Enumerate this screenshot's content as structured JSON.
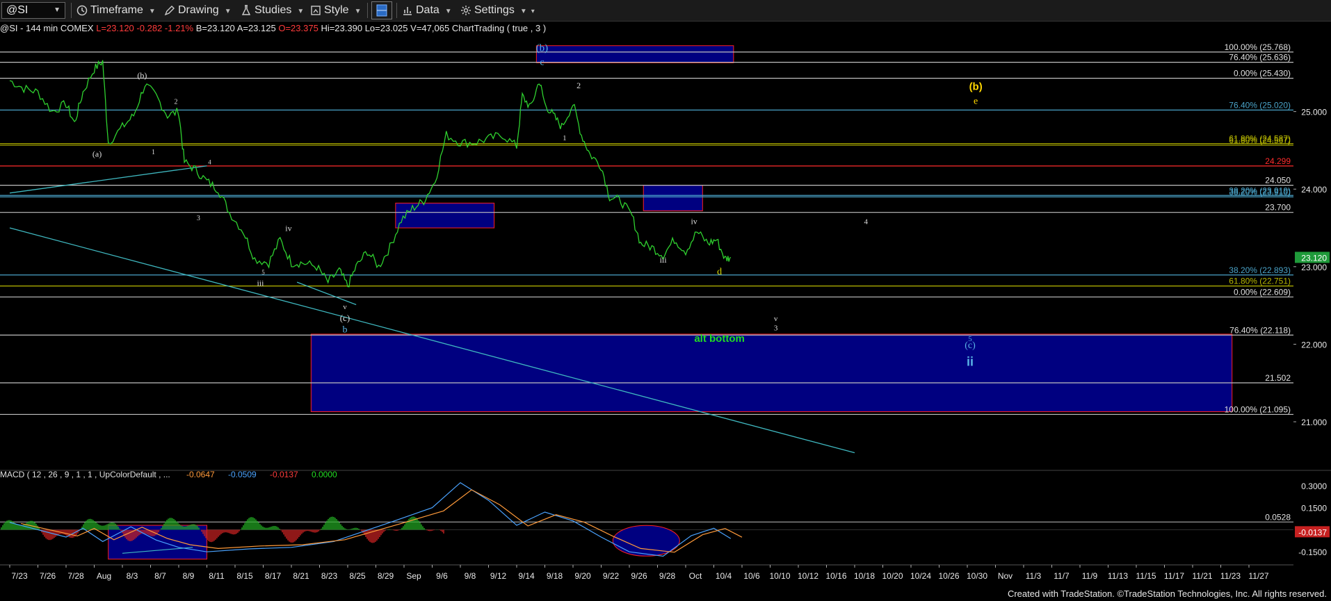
{
  "toolbar": {
    "symbol": "@SI",
    "timeframe": "Timeframe",
    "drawing": "Drawing",
    "studies": "Studies",
    "style": "Style",
    "data": "Data",
    "settings": "Settings"
  },
  "infoline": {
    "symbol": "@SI - 144 min",
    "exchange": "COMEX",
    "last": "L=23.120",
    "change": "-0.282",
    "change_pct": "-1.21%",
    "bid": "B=23.120",
    "ask": "A=23.125",
    "open": "O=23.375",
    "high": "Hi=23.390",
    "low": "Lo=23.025",
    "volume": "V=47,065",
    "study": "ChartTrading ( true , 3 )"
  },
  "footer": "Created with TradeStation. ©TradeStation Technologies, Inc. All rights reserved.",
  "chart_data": [
    {
      "type": "line",
      "title": "@SI - 144 min COMEX",
      "x_dates": [
        "7/23",
        "7/26",
        "7/28",
        "Aug",
        "8/3",
        "8/7",
        "8/9",
        "8/11",
        "8/15",
        "8/17",
        "8/21",
        "8/23",
        "8/25",
        "8/29",
        "Sep",
        "9/6",
        "9/8",
        "9/12",
        "9/14",
        "9/18",
        "9/20",
        "9/22",
        "9/26",
        "9/28",
        "Oct",
        "10/4",
        "10/6",
        "10/10",
        "10/12",
        "10/16",
        "10/18",
        "10/20",
        "10/24",
        "10/26",
        "10/30",
        "Nov",
        "11/3",
        "11/7",
        "11/9",
        "11/13",
        "11/15",
        "11/17",
        "11/21",
        "11/23",
        "11/27"
      ],
      "ylim": [
        20.4,
        26.0
      ],
      "y_ticks": [
        "25.000",
        "24.000",
        "23.000",
        "22.000",
        "21.000"
      ],
      "last_price": "23.120",
      "price_path": [
        [
          0,
          25.4
        ],
        [
          0.5,
          25.3
        ],
        [
          1,
          25.25
        ],
        [
          1.5,
          25.0
        ],
        [
          2,
          25.1
        ],
        [
          2.3,
          24.85
        ],
        [
          2.6,
          25.25
        ],
        [
          3.0,
          25.55
        ],
        [
          3.3,
          25.65
        ],
        [
          3.5,
          24.6
        ],
        [
          4.0,
          24.8
        ],
        [
          4.4,
          24.95
        ],
        [
          4.8,
          25.35
        ],
        [
          5.2,
          25.2
        ],
        [
          5.6,
          24.95
        ],
        [
          6.0,
          25.0
        ],
        [
          6.2,
          24.35
        ],
        [
          6.6,
          24.25
        ],
        [
          7.0,
          24.1
        ],
        [
          7.4,
          24.0
        ],
        [
          7.8,
          23.7
        ],
        [
          8.3,
          23.45
        ],
        [
          8.7,
          23.1
        ],
        [
          9.2,
          23.05
        ],
        [
          9.6,
          23.35
        ],
        [
          10.0,
          23.05
        ],
        [
          10.4,
          23.05
        ],
        [
          10.9,
          23.0
        ],
        [
          11.3,
          22.8
        ],
        [
          11.7,
          22.95
        ],
        [
          12.0,
          22.75
        ],
        [
          12.3,
          23.0
        ],
        [
          12.7,
          23.2
        ],
        [
          13.1,
          23.0
        ],
        [
          13.5,
          23.25
        ],
        [
          13.9,
          23.6
        ],
        [
          14.3,
          23.75
        ],
        [
          14.7,
          23.85
        ],
        [
          15.1,
          24.1
        ],
        [
          15.5,
          24.7
        ],
        [
          16.0,
          24.6
        ],
        [
          16.5,
          24.6
        ],
        [
          17.0,
          24.65
        ],
        [
          17.5,
          24.7
        ],
        [
          18.0,
          24.55
        ],
        [
          18.2,
          25.2
        ],
        [
          18.5,
          25.05
        ],
        [
          18.8,
          25.4
        ],
        [
          19.0,
          25.1
        ],
        [
          19.3,
          24.95
        ],
        [
          19.6,
          24.8
        ],
        [
          20.0,
          25.1
        ],
        [
          20.3,
          24.7
        ],
        [
          20.6,
          24.45
        ],
        [
          21.0,
          24.3
        ],
        [
          21.3,
          23.9
        ],
        [
          21.7,
          23.85
        ],
        [
          22.1,
          23.65
        ],
        [
          22.4,
          23.3
        ],
        [
          22.8,
          23.25
        ],
        [
          23.2,
          23.15
        ],
        [
          23.6,
          23.35
        ],
        [
          24.0,
          23.2
        ],
        [
          24.4,
          23.45
        ],
        [
          24.8,
          23.3
        ],
        [
          25.1,
          23.35
        ],
        [
          25.4,
          23.1
        ],
        [
          25.6,
          23.12
        ]
      ],
      "overlays": {
        "zones": [
          {
            "x": [
              18.7,
              25.7
            ],
            "y": [
              25.63,
              25.85
            ]
          },
          {
            "x": [
              13.7,
              17.2
            ],
            "y": [
              23.5,
              23.82
            ]
          },
          {
            "x": [
              22.5,
              24.6
            ],
            "y": [
              23.72,
              24.05
            ]
          },
          {
            "x": [
              10.7,
              43.4
            ],
            "y": [
              21.13,
              22.13
            ]
          }
        ],
        "levels": [
          {
            "label": "100.00% (25.768)",
            "value": 25.768,
            "color": "#c0c0c0"
          },
          {
            "label": "76.40% (25.636)",
            "value": 25.636,
            "color": "#c0c0c0"
          },
          {
            "label": "0.00% (25.430)",
            "value": 25.43,
            "color": "#c0c0c0"
          },
          {
            "label": "76.40% (25.020)",
            "value": 25.02,
            "color": "#4aa3c8"
          },
          {
            "label": "61.80% (24.587)",
            "value": 24.587,
            "color": "#b8b800"
          },
          {
            "label": "61.80% (24.567)",
            "value": 24.567,
            "color": "#b8b800"
          },
          {
            "label": "24.299",
            "value": 24.299,
            "color": "#ff2b2b"
          },
          {
            "label": "24.050",
            "value": 24.05,
            "color": "#c0c0c0"
          },
          {
            "label": "38.20% (23.919)",
            "value": 23.919,
            "color": "#4aa3c8"
          },
          {
            "label": "38.20% (23.910)",
            "value": 23.9,
            "color": "#4aa3c8"
          },
          {
            "label": "23.700",
            "value": 23.7,
            "color": "#c0c0c0"
          },
          {
            "label": "38.20% (22.893)",
            "value": 22.893,
            "color": "#4aa3c8"
          },
          {
            "label": "61.80% (22.751)",
            "value": 22.751,
            "color": "#b8b800"
          },
          {
            "label": "0.00% (22.609)",
            "value": 22.609,
            "color": "#c0c0c0"
          },
          {
            "label": "76.40% (22.118)",
            "value": 22.118,
            "color": "#c0c0c0"
          },
          {
            "label": "21.502",
            "value": 21.502,
            "color": "#c0c0c0"
          },
          {
            "label": "100.00% (21.095)",
            "value": 21.095,
            "color": "#c0c0c0"
          }
        ],
        "annotations": [
          {
            "text": "(b)",
            "x": 18.9,
            "y": 25.78,
            "color": "#5ab4e6",
            "size": 15
          },
          {
            "text": "c",
            "x": 18.9,
            "y": 25.6,
            "color": "#5ab4e6",
            "size": 14
          },
          {
            "text": "(b)",
            "x": 4.7,
            "y": 25.43,
            "color": "#dddddd",
            "size": 12
          },
          {
            "text": "2",
            "x": 5.9,
            "y": 25.1,
            "color": "#dddddd",
            "size": 10
          },
          {
            "text": "(a)",
            "x": 3.1,
            "y": 24.42,
            "color": "#dddddd",
            "size": 12
          },
          {
            "text": "1",
            "x": 5.1,
            "y": 24.45,
            "color": "#dddddd",
            "size": 10
          },
          {
            "text": "4",
            "x": 7.1,
            "y": 24.32,
            "color": "#dddddd",
            "size": 9
          },
          {
            "text": "3",
            "x": 6.7,
            "y": 23.6,
            "color": "#dddddd",
            "size": 10
          },
          {
            "text": "iv",
            "x": 9.9,
            "y": 23.46,
            "color": "#dddddd",
            "size": 12
          },
          {
            "text": "5",
            "x": 9.0,
            "y": 22.9,
            "color": "#dddddd",
            "size": 9
          },
          {
            "text": "iii",
            "x": 8.9,
            "y": 22.75,
            "color": "#dddddd",
            "size": 12
          },
          {
            "text": "v",
            "x": 11.9,
            "y": 22.45,
            "color": "#dddddd",
            "size": 11
          },
          {
            "text": "(c)",
            "x": 11.9,
            "y": 22.3,
            "color": "#dddddd",
            "size": 13
          },
          {
            "text": "b",
            "x": 11.9,
            "y": 22.15,
            "color": "#5ab4e6",
            "size": 14
          },
          {
            "text": "2",
            "x": 20.2,
            "y": 25.3,
            "color": "#dddddd",
            "size": 12
          },
          {
            "text": "1",
            "x": 19.7,
            "y": 24.63,
            "color": "#dddddd",
            "size": 11
          },
          {
            "text": "iv",
            "x": 24.3,
            "y": 23.55,
            "color": "#dddddd",
            "size": 12
          },
          {
            "text": "iii",
            "x": 23.2,
            "y": 23.05,
            "color": "#dddddd",
            "size": 12
          },
          {
            "text": "d",
            "x": 25.2,
            "y": 22.9,
            "color": "#d8d800",
            "size": 14
          },
          {
            "text": "4",
            "x": 30.4,
            "y": 23.55,
            "color": "#dddddd",
            "size": 11
          },
          {
            "text": "v",
            "x": 27.2,
            "y": 22.3,
            "color": "#dddddd",
            "size": 11
          },
          {
            "text": "3",
            "x": 27.2,
            "y": 22.18,
            "color": "#dddddd",
            "size": 11
          },
          {
            "text": "alt bottom",
            "x": 25.2,
            "y": 22.03,
            "color": "#22dd22",
            "size": 15,
            "bold": true
          },
          {
            "text": "5",
            "x": 34.1,
            "y": 22.04,
            "color": "#5ab4e6",
            "size": 11
          },
          {
            "text": "(c)",
            "x": 34.1,
            "y": 21.95,
            "color": "#5ab4e6",
            "size": 14
          },
          {
            "text": "ii",
            "x": 34.1,
            "y": 21.72,
            "color": "#5ab4e6",
            "size": 18,
            "bold": true
          },
          {
            "text": "(b)",
            "x": 34.3,
            "y": 25.28,
            "color": "#ffd700",
            "size": 15,
            "bold": true
          },
          {
            "text": "e",
            "x": 34.3,
            "y": 25.1,
            "color": "#ffd700",
            "size": 14
          }
        ],
        "trendlines": [
          {
            "from": [
              0,
              23.95
            ],
            "to": [
              7.0,
              24.3
            ]
          },
          {
            "from": [
              0,
              23.5
            ],
            "to": [
              30.0,
              20.6
            ]
          },
          {
            "from": [
              10.2,
              22.8
            ],
            "to": [
              12.3,
              22.51
            ]
          }
        ]
      }
    },
    {
      "type": "line",
      "title": "MACD ( 12 , 26 , 9 , 1 , 1 , UpColorDefault , ...",
      "header_values": [
        "-0.0647",
        "-0.0509",
        "-0.0137",
        "0.0000"
      ],
      "ylim": [
        -0.22,
        0.38
      ],
      "y_ticks": [
        "0.3000",
        "0.1500",
        "-0.1500"
      ],
      "ref_level": {
        "label": "0.0528",
        "value": 0.0528
      },
      "last_value": "-0.0137"
    }
  ]
}
